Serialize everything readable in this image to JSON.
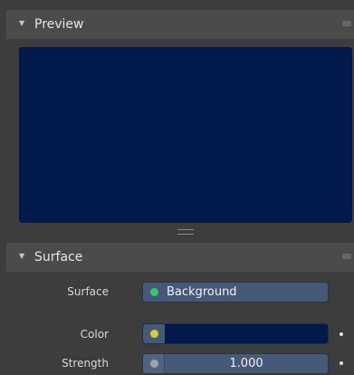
{
  "preview_panel": {
    "title": "Preview",
    "preview_color": "#021a4b"
  },
  "surface_panel": {
    "title": "Surface",
    "properties": {
      "surface": {
        "label": "Surface",
        "value": "Background",
        "socket_color": "#3bc56e"
      },
      "color": {
        "label": "Color",
        "swatch_color": "#021a4b",
        "socket_color": "#d8cc3a"
      },
      "strength": {
        "label": "Strength",
        "value": "1.000",
        "socket_color": "#a3a3a3"
      }
    }
  },
  "colors": {
    "panel_bg": "#3d3d3d",
    "header_bg": "#4b4b4b",
    "field_bg": "#465a77",
    "text": "#e6e6e6"
  }
}
